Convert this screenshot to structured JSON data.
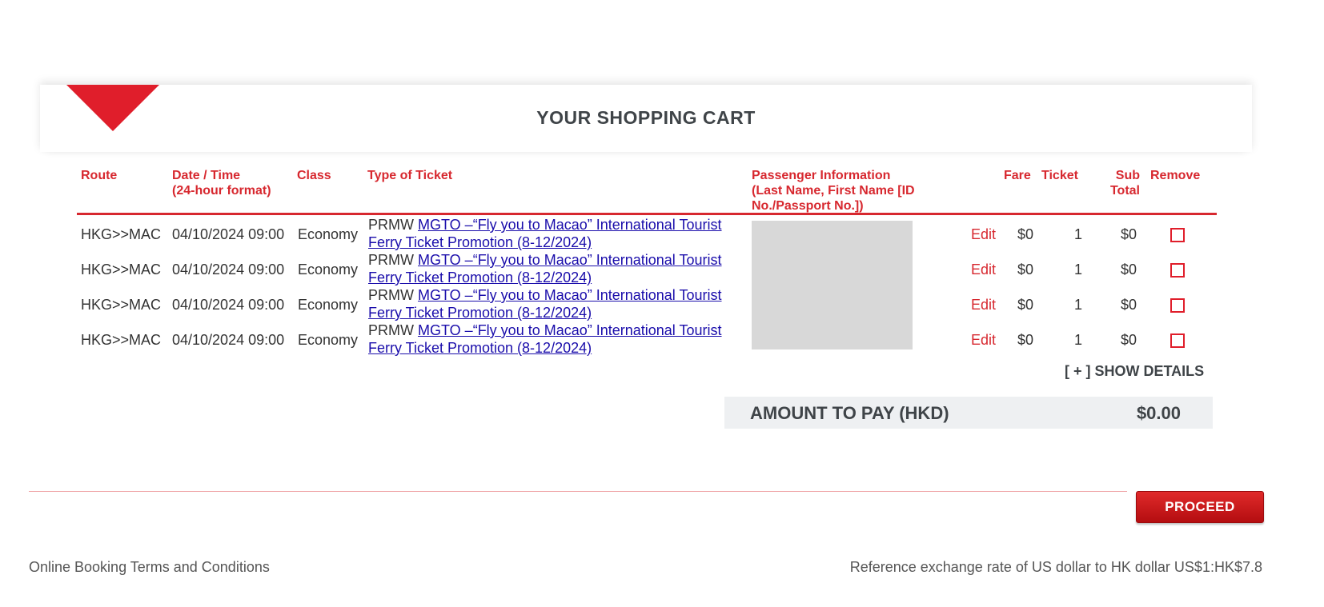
{
  "cart": {
    "title": "YOUR SHOPPING CART"
  },
  "table": {
    "headers": {
      "route": "Route",
      "datetime_line1": "Date / Time",
      "datetime_line2": "(24-hour format)",
      "class": "Class",
      "ticket_type": "Type of Ticket",
      "passenger_line1": "Passenger Information",
      "passenger_line2": "(Last Name, First Name [ID",
      "passenger_line3": "No./Passport No.])",
      "fare": "Fare",
      "ticket": "Ticket",
      "subtotal_line1": "Sub",
      "subtotal_line2": "Total",
      "remove": "Remove"
    },
    "rows": [
      {
        "route": "HKG>>MAC",
        "datetime": "04/10/2024 09:00",
        "class": "Economy",
        "ticket_prefix": "PRMW",
        "ticket_link": "MGTO –“Fly you to Macao” International Tourist Ferry Ticket Promotion (8-12/2024)",
        "edit": "Edit",
        "fare": "$0",
        "ticket": "1",
        "subtotal": "$0"
      },
      {
        "route": "HKG>>MAC",
        "datetime": "04/10/2024 09:00",
        "class": "Economy",
        "ticket_prefix": "PRMW",
        "ticket_link": "MGTO –“Fly you to Macao” International Tourist Ferry Ticket Promotion (8-12/2024)",
        "edit": "Edit",
        "fare": "$0",
        "ticket": "1",
        "subtotal": "$0"
      },
      {
        "route": "HKG>>MAC",
        "datetime": "04/10/2024 09:00",
        "class": "Economy",
        "ticket_prefix": "PRMW",
        "ticket_link": "MGTO –“Fly you to Macao” International Tourist Ferry Ticket Promotion (8-12/2024)",
        "edit": "Edit",
        "fare": "$0",
        "ticket": "1",
        "subtotal": "$0"
      },
      {
        "route": "HKG>>MAC",
        "datetime": "04/10/2024 09:00",
        "class": "Economy",
        "ticket_prefix": "PRMW",
        "ticket_link": "MGTO –“Fly you to Macao” International Tourist Ferry Ticket Promotion (8-12/2024)",
        "edit": "Edit",
        "fare": "$0",
        "ticket": "1",
        "subtotal": "$0"
      }
    ]
  },
  "summary": {
    "show_details": "[ + ] SHOW DETAILS",
    "amount_label": "AMOUNT TO PAY (HKD)",
    "amount_value": "$0.00"
  },
  "actions": {
    "proceed": "PROCEED"
  },
  "footer": {
    "terms_link": "Online Booking Terms and Conditions",
    "exchange_note": "Reference exchange rate of US dollar to HK dollar US$1:HK$7.8"
  },
  "colors": {
    "accent_red": "#d7282f",
    "link_blue": "#1a0dab"
  }
}
